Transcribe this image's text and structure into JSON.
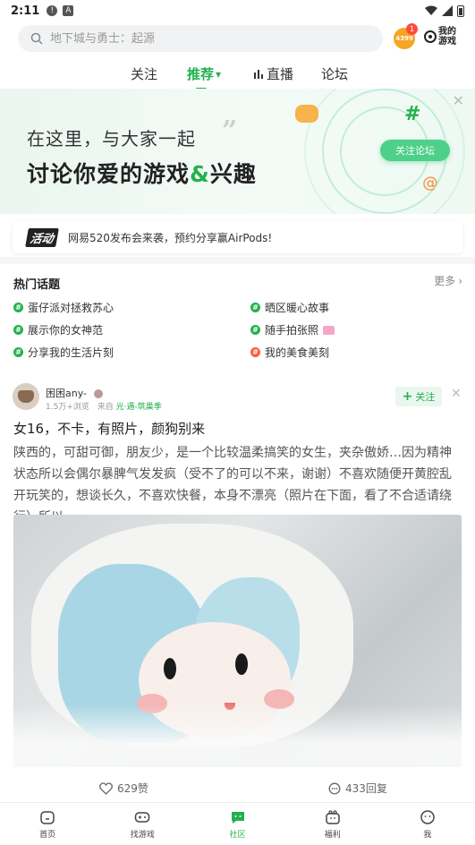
{
  "status_bar": {
    "time": "2:11",
    "icon_a": "!",
    "icon_b": "A"
  },
  "search": {
    "placeholder": "地下城与勇士：起源"
  },
  "header": {
    "badge_4399": "4399",
    "badge_count": "1",
    "my_games": "我的游戏"
  },
  "tabs": [
    {
      "label": "关注",
      "active": false
    },
    {
      "label": "推荐",
      "active": true,
      "chevron": "⌄"
    },
    {
      "label": "直播",
      "active": false,
      "icon": "live-icon"
    },
    {
      "label": "论坛",
      "active": false
    }
  ],
  "banner": {
    "line1": "在这里，与大家一起",
    "line2_a": "讨论你爱的游戏",
    "line2_amp": "&",
    "line2_b": "兴趣",
    "quote_mark": "”",
    "button": "关注论坛",
    "hash": "#",
    "at": "@",
    "close": "✕"
  },
  "activity": {
    "tag": "活动",
    "text": "网易520发布会来袭，预约分享赢AirPods!"
  },
  "hot_topics": {
    "title": "热门话题",
    "more": "更多",
    "items": [
      {
        "label": "蛋仔派对拯救苏心",
        "icon": "topic-icon"
      },
      {
        "label": "晒区暖心故事",
        "icon": "topic-icon"
      },
      {
        "label": "展示你的女神范",
        "icon": "topic-icon"
      },
      {
        "label": "随手拍张照",
        "icon": "topic-icon"
      },
      {
        "label": "分享我的生活片刻",
        "icon": "topic-icon"
      },
      {
        "label": "我的美食美刻",
        "icon": "hot-icon"
      }
    ]
  },
  "post": {
    "author": "困困any-",
    "views": "1.5万+浏览",
    "source_prefix": "来自",
    "source": "光·遇-筑巢季",
    "follow": "关注",
    "close": "✕",
    "title": "女16，不卡，有照片，颜狗别来",
    "body": "陕西的，可甜可御，朋友少，是一个比较温柔搞笑的女生，夹杂傲娇…因为精神状态所以会偶尔暴脾气发发疯（受不了的可以不来，谢谢）不喜欢随便开黄腔乱开玩笑的，想谈长久，不喜欢快餐，本身不漂亮（照片在下面，看了不合适请绕行）所以…",
    "likes": "629赞",
    "replies": "433回复"
  },
  "bottom_nav": [
    {
      "label": "首页",
      "icon": "home-icon",
      "active": false
    },
    {
      "label": "找游戏",
      "icon": "gamepad-icon",
      "active": false
    },
    {
      "label": "社区",
      "icon": "community-icon",
      "active": true
    },
    {
      "label": "福利",
      "icon": "gift-icon",
      "active": false
    },
    {
      "label": "我",
      "icon": "profile-icon",
      "active": false
    }
  ],
  "colors": {
    "accent": "#23b14d",
    "hot": "#ff5a3c",
    "badge": "#f5a623"
  }
}
